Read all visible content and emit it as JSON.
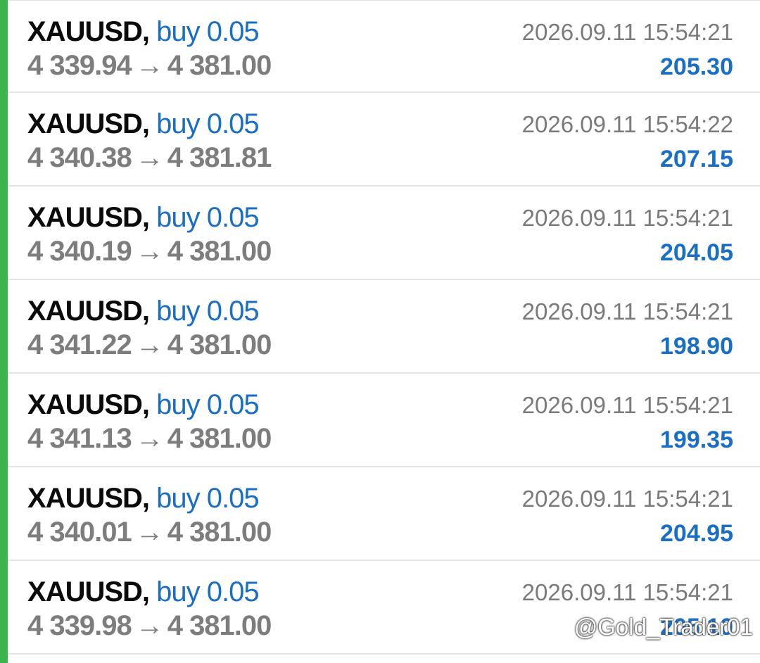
{
  "theme": {
    "accent": "#3ab54a",
    "profit_color": "#1a6fc4",
    "symbol_color": "#0b0b0b",
    "muted": "#7d7d7d"
  },
  "trades": [
    {
      "symbol": "XAUUSD,",
      "side": "buy 0.05",
      "open": "4 339.94",
      "close": "4 381.00",
      "time": "2026.09.11 15:54:21",
      "profit": "205.30"
    },
    {
      "symbol": "XAUUSD,",
      "side": "buy 0.05",
      "open": "4 340.38",
      "close": "4 381.81",
      "time": "2026.09.11 15:54:22",
      "profit": "207.15"
    },
    {
      "symbol": "XAUUSD,",
      "side": "buy 0.05",
      "open": "4 340.19",
      "close": "4 381.00",
      "time": "2026.09.11 15:54:21",
      "profit": "204.05"
    },
    {
      "symbol": "XAUUSD,",
      "side": "buy 0.05",
      "open": "4 341.22",
      "close": "4 381.00",
      "time": "2026.09.11 15:54:21",
      "profit": "198.90"
    },
    {
      "symbol": "XAUUSD,",
      "side": "buy 0.05",
      "open": "4 341.13",
      "close": "4 381.00",
      "time": "2026.09.11 15:54:21",
      "profit": "199.35"
    },
    {
      "symbol": "XAUUSD,",
      "side": "buy 0.05",
      "open": "4 340.01",
      "close": "4 381.00",
      "time": "2026.09.11 15:54:21",
      "profit": "204.95"
    },
    {
      "symbol": "XAUUSD,",
      "side": "buy 0.05",
      "open": "4 339.98",
      "close": "4 381.00",
      "time": "2026.09.11 15:54:21",
      "profit": "205.10"
    }
  ],
  "arrow_glyph": "→",
  "watermark": {
    "icon": "threads-icon",
    "text": "@Gold_Trader01"
  }
}
